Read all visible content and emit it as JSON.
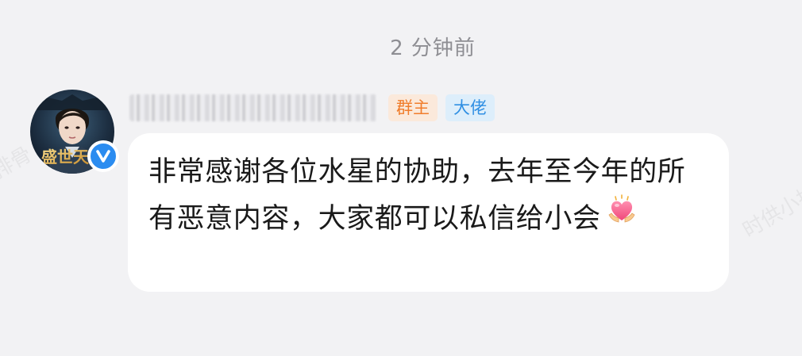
{
  "chat": {
    "timestamp": "2 分钟前",
    "sender": {
      "avatar_icon": "avatar-image",
      "verified_icon": "verified-v-icon",
      "role_badges": [
        {
          "label": "群主",
          "bg": "#fbe9db",
          "color": "#f07d2c"
        },
        {
          "label": "大佬",
          "bg": "#ddeefb",
          "color": "#2f8fe3"
        }
      ]
    },
    "message": {
      "text": "非常感谢各位水星的协助，去年至今年的所有恶意内容，大家都可以私信给小会",
      "emoji": "heart-hands-emoji"
    }
  },
  "colors": {
    "background": "#f2f2f4",
    "bubble": "#ffffff",
    "accent_blue": "#2b8cf0"
  }
}
